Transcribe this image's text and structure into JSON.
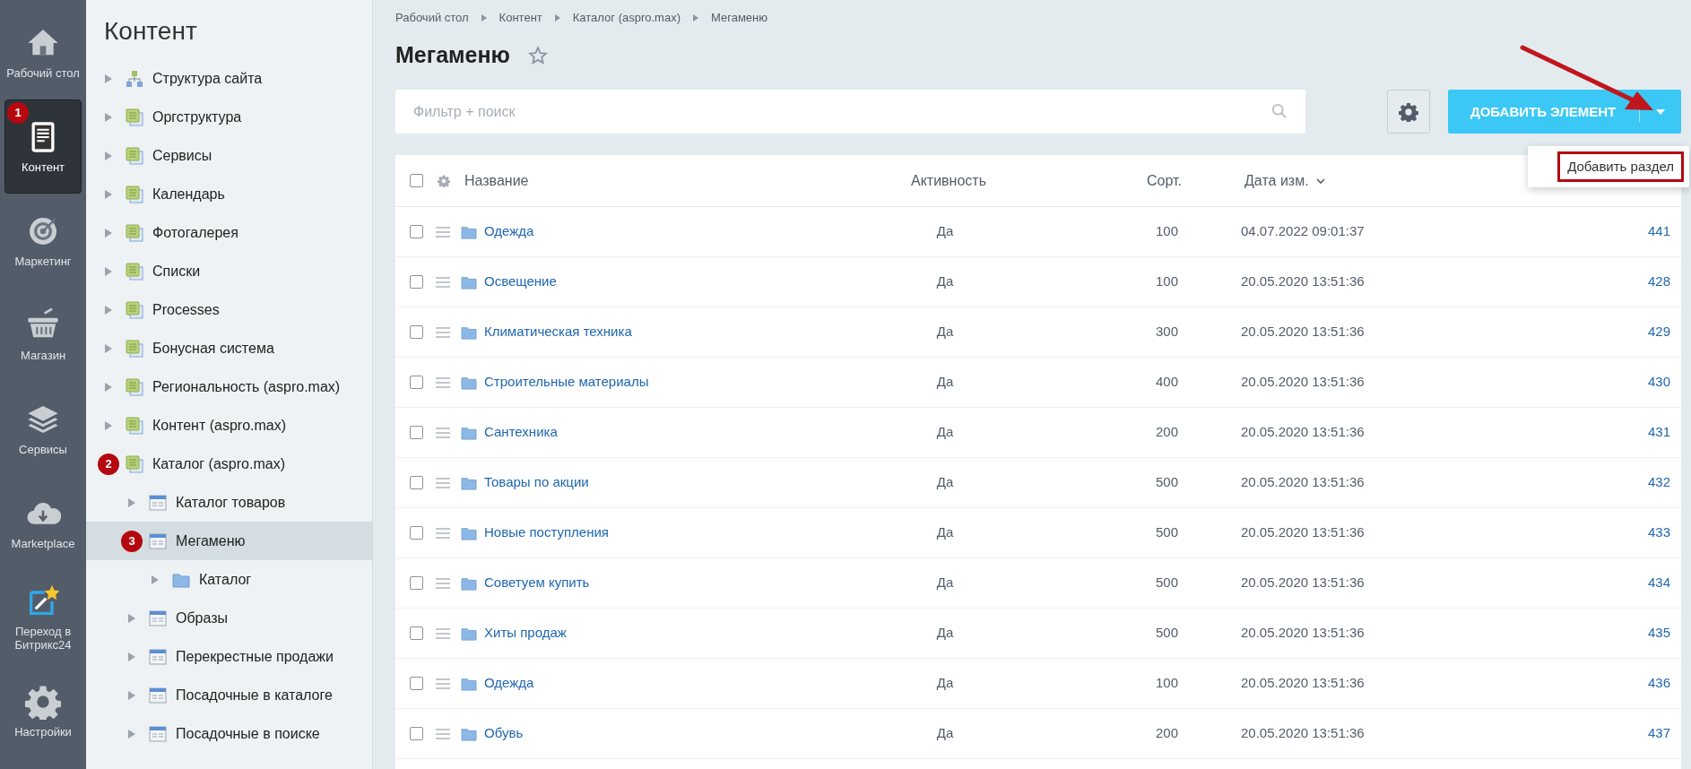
{
  "nav": [
    {
      "label": "Рабочий стол",
      "selected": false
    },
    {
      "label": "Контент",
      "selected": true,
      "badge": "1"
    },
    {
      "label": "Маркетинг",
      "selected": false
    },
    {
      "label": "Магазин",
      "selected": false
    },
    {
      "label": "Сервисы",
      "selected": false
    },
    {
      "label": "Marketplace",
      "selected": false
    },
    {
      "label": "Переход в Битрикс24",
      "selected": false
    },
    {
      "label": "Настройки",
      "selected": false
    }
  ],
  "sidebar": {
    "title": "Контент",
    "items": [
      {
        "label": "Структура сайта",
        "kind": "structure",
        "selected": false
      },
      {
        "label": "Оргструктура",
        "kind": "type",
        "selected": false
      },
      {
        "label": "Сервисы",
        "kind": "type",
        "selected": false
      },
      {
        "label": "Календарь",
        "kind": "type",
        "selected": false
      },
      {
        "label": "Фотогалерея",
        "kind": "type",
        "selected": false
      },
      {
        "label": "Списки",
        "kind": "type",
        "selected": false
      },
      {
        "label": "Processes",
        "kind": "type",
        "selected": false
      },
      {
        "label": "Бонусная система",
        "kind": "type",
        "selected": false
      },
      {
        "label": "Региональность (aspro.max)",
        "kind": "type",
        "selected": false
      },
      {
        "label": "Контент (aspro.max)",
        "kind": "type",
        "selected": false
      },
      {
        "label": "Каталог (aspro.max)",
        "kind": "type",
        "selected": false,
        "badge": "2",
        "children": [
          {
            "label": "Каталог товаров",
            "kind": "block",
            "selected": false
          },
          {
            "label": "Мегаменю",
            "kind": "block",
            "selected": true,
            "badge": "3",
            "children": [
              {
                "label": "Каталог",
                "kind": "folder",
                "selected": false
              }
            ]
          },
          {
            "label": "Образы",
            "kind": "block",
            "selected": false
          },
          {
            "label": "Перекрестные продажи",
            "kind": "block",
            "selected": false
          },
          {
            "label": "Посадочные в каталоге",
            "kind": "block",
            "selected": false
          },
          {
            "label": "Посадочные в поиске",
            "kind": "block",
            "selected": false
          }
        ]
      }
    ]
  },
  "breadcrumbs": [
    "Рабочий стол",
    "Контент",
    "Каталог (aspro.max)",
    "Мегаменю"
  ],
  "page_title": "Мегаменю",
  "filter": {
    "placeholder": "Фильтр + поиск"
  },
  "add_button": {
    "label": "ДОБАВИТЬ ЭЛЕМЕНТ"
  },
  "dropdown": {
    "items": [
      {
        "label": "Добавить раздел",
        "highlighted": true
      }
    ]
  },
  "table": {
    "select_all_checked": false,
    "columns": [
      "Название",
      "Активность",
      "Сорт.",
      "Дата изм."
    ],
    "rows": [
      {
        "checked": false,
        "name": "Одежда",
        "active": "Да",
        "sort": "100",
        "date": "04.07.2022 09:01:37",
        "id": "441"
      },
      {
        "checked": false,
        "name": "Освещение",
        "active": "Да",
        "sort": "100",
        "date": "20.05.2020 13:51:36",
        "id": "428"
      },
      {
        "checked": false,
        "name": "Климатическая техника",
        "active": "Да",
        "sort": "300",
        "date": "20.05.2020 13:51:36",
        "id": "429"
      },
      {
        "checked": false,
        "name": "Строительные материалы",
        "active": "Да",
        "sort": "400",
        "date": "20.05.2020 13:51:36",
        "id": "430"
      },
      {
        "checked": false,
        "name": "Сантехника",
        "active": "Да",
        "sort": "200",
        "date": "20.05.2020 13:51:36",
        "id": "431"
      },
      {
        "checked": false,
        "name": "Товары по акции",
        "active": "Да",
        "sort": "500",
        "date": "20.05.2020 13:51:36",
        "id": "432"
      },
      {
        "checked": false,
        "name": "Новые поступления",
        "active": "Да",
        "sort": "500",
        "date": "20.05.2020 13:51:36",
        "id": "433"
      },
      {
        "checked": false,
        "name": "Советуем купить",
        "active": "Да",
        "sort": "500",
        "date": "20.05.2020 13:51:36",
        "id": "434"
      },
      {
        "checked": false,
        "name": "Хиты продаж",
        "active": "Да",
        "sort": "500",
        "date": "20.05.2020 13:51:36",
        "id": "435"
      },
      {
        "checked": false,
        "name": "Одежда",
        "active": "Да",
        "sort": "100",
        "date": "20.05.2020 13:51:36",
        "id": "436"
      },
      {
        "checked": false,
        "name": "Обувь",
        "active": "Да",
        "sort": "200",
        "date": "20.05.2020 13:51:36",
        "id": "437"
      }
    ]
  }
}
